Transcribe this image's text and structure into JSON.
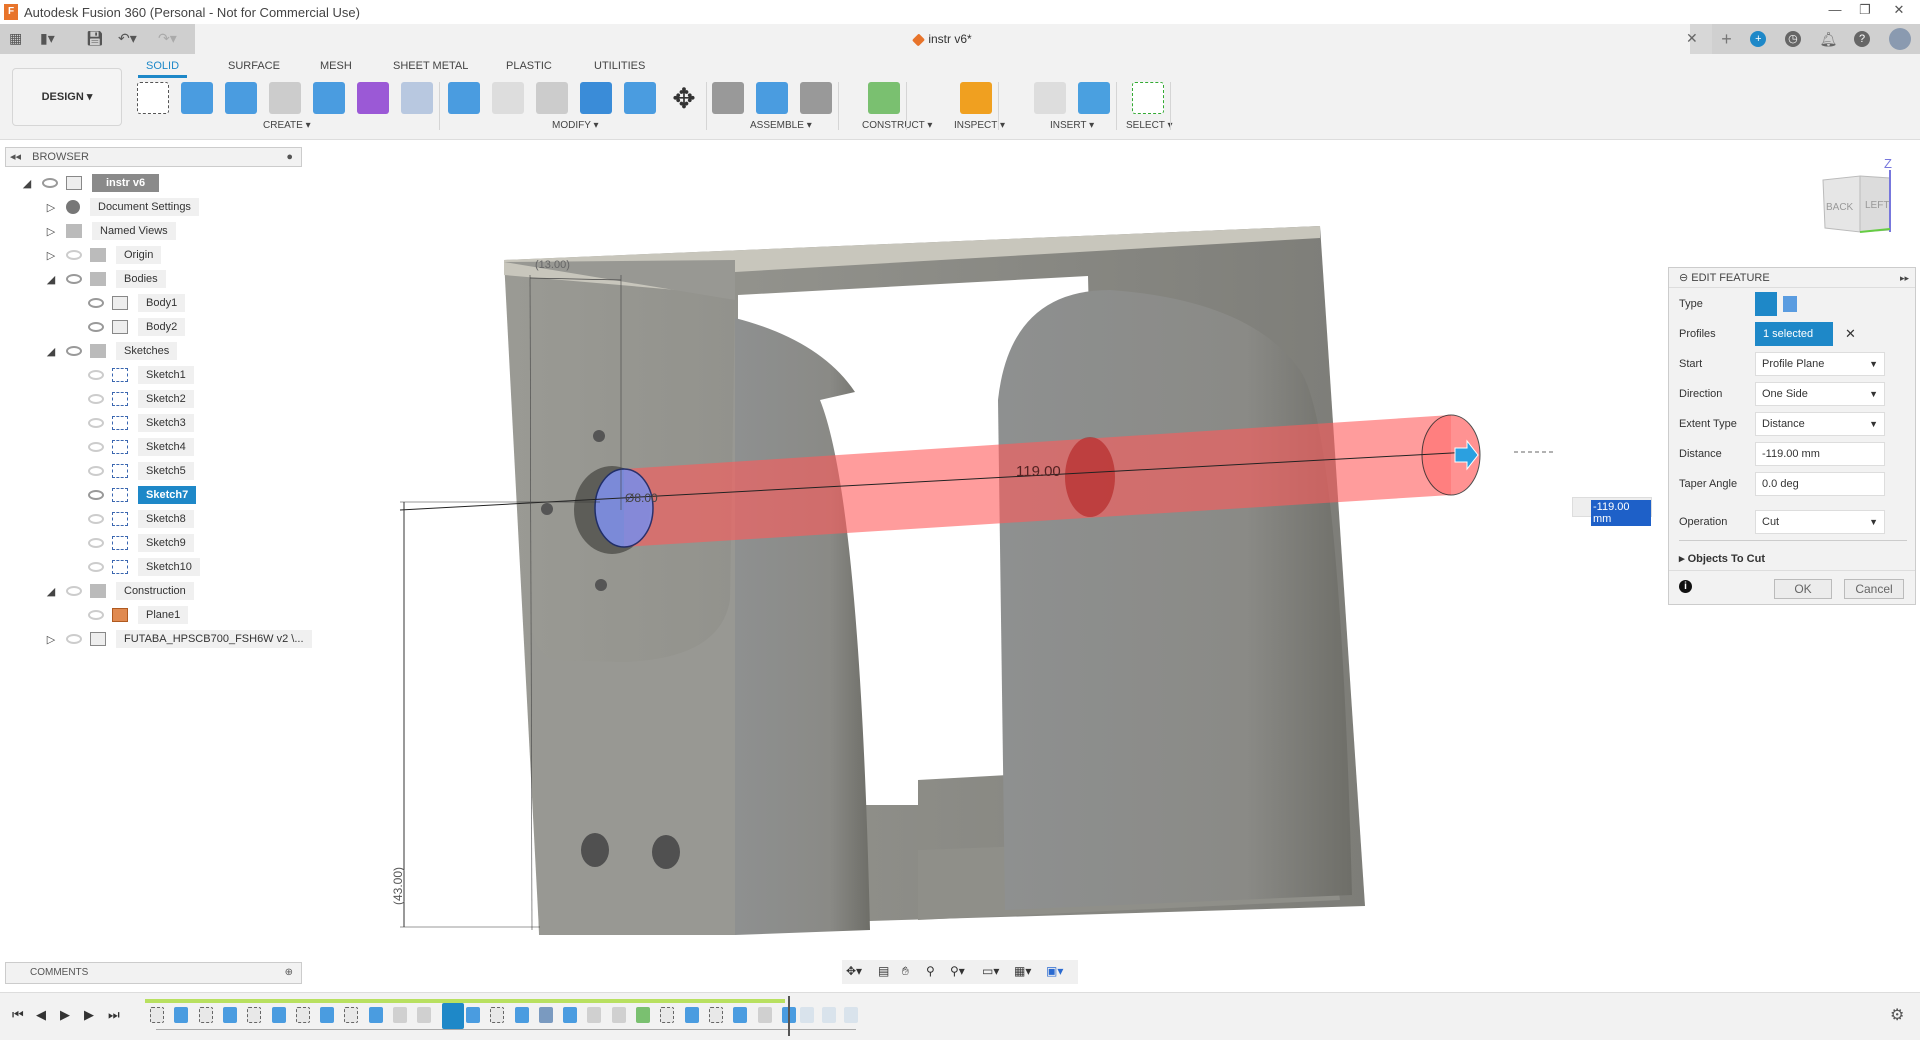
{
  "app": {
    "title": "Autodesk Fusion 360 (Personal - Not for Commercial Use)",
    "document_tab": "instr v6*"
  },
  "colors": {
    "accent": "#1e88c8",
    "cut_preview": "#ff5a5a",
    "profile": "#7f8fe6",
    "body": "#8c8c86"
  },
  "ribbon": {
    "workspace": "DESIGN ▾",
    "tabs": [
      "SOLID",
      "SURFACE",
      "MESH",
      "SHEET METAL",
      "PLASTIC",
      "UTILITIES"
    ],
    "active_tab": "SOLID",
    "groups": [
      {
        "label": "CREATE ▾",
        "icons": [
          "create-sketch-icon",
          "extrude-icon",
          "revolve-icon",
          "hole-icon",
          "pattern-icon",
          "create-form-icon",
          "sweep-icon"
        ]
      },
      {
        "label": "MODIFY ▾",
        "icons": [
          "press-pull-icon",
          "fillet-icon",
          "shell-icon",
          "combine-icon",
          "split-face-icon",
          "move-icon"
        ]
      },
      {
        "label": "ASSEMBLE ▾",
        "icons": [
          "joint-icon",
          "new-component-icon",
          "as-built-joint-icon"
        ]
      },
      {
        "label": "CONSTRUCT ▾",
        "icons": [
          "offset-plane-icon"
        ]
      },
      {
        "label": "INSPECT ▾",
        "icons": [
          "measure-icon"
        ]
      },
      {
        "label": "INSERT ▾",
        "icons": [
          "insert-derive-icon",
          "insert-canvas-icon"
        ]
      },
      {
        "label": "SELECT ▾",
        "icons": [
          "select-window-icon"
        ]
      }
    ]
  },
  "browser": {
    "title": "BROWSER",
    "items": [
      {
        "label": "instr v6",
        "level": 0,
        "expanded": true,
        "icon": "component",
        "eye": "on",
        "style": "root"
      },
      {
        "label": "Document Settings",
        "level": 1,
        "expanded": false,
        "icon": "gear",
        "eye": "none"
      },
      {
        "label": "Named Views",
        "level": 1,
        "expanded": false,
        "icon": "folder",
        "eye": "none"
      },
      {
        "label": "Origin",
        "level": 1,
        "expanded": false,
        "icon": "folder",
        "eye": "off"
      },
      {
        "label": "Bodies",
        "level": 1,
        "expanded": true,
        "icon": "folder",
        "eye": "on"
      },
      {
        "label": "Body1",
        "level": 2,
        "icon": "body",
        "eye": "on"
      },
      {
        "label": "Body2",
        "level": 2,
        "icon": "body",
        "eye": "on"
      },
      {
        "label": "Sketches",
        "level": 1,
        "expanded": true,
        "icon": "folder",
        "eye": "on"
      },
      {
        "label": "Sketch1",
        "level": 2,
        "icon": "sketch",
        "eye": "off"
      },
      {
        "label": "Sketch2",
        "level": 2,
        "icon": "sketch",
        "eye": "off"
      },
      {
        "label": "Sketch3",
        "level": 2,
        "icon": "sketch",
        "eye": "off"
      },
      {
        "label": "Sketch4",
        "level": 2,
        "icon": "sketch",
        "eye": "off"
      },
      {
        "label": "Sketch5",
        "level": 2,
        "icon": "sketch",
        "eye": "off"
      },
      {
        "label": "Sketch7",
        "level": 2,
        "icon": "sketch",
        "eye": "on",
        "style": "sel"
      },
      {
        "label": "Sketch8",
        "level": 2,
        "icon": "sketch",
        "eye": "off"
      },
      {
        "label": "Sketch9",
        "level": 2,
        "icon": "sketch",
        "eye": "off"
      },
      {
        "label": "Sketch10",
        "level": 2,
        "icon": "sketch",
        "eye": "off"
      },
      {
        "label": "Construction",
        "level": 1,
        "expanded": true,
        "icon": "folder",
        "eye": "off"
      },
      {
        "label": "Plane1",
        "level": 2,
        "icon": "plane",
        "eye": "off"
      },
      {
        "label": "FUTABA_HPSCB700_FSH6W v2 \\...",
        "level": 1,
        "expanded": false,
        "icon": "component",
        "eye": "off"
      }
    ]
  },
  "viewport": {
    "dims": {
      "top": "(13.00)",
      "diameter": "Ø8.00",
      "length": "119.00",
      "vertical": "(43.00)"
    },
    "floating_input": "-119.00 mm",
    "viewcube": {
      "faces": [
        "BACK",
        "LEFT"
      ],
      "axis": "Z"
    }
  },
  "edit_feature": {
    "title": "EDIT FEATURE",
    "rows": [
      {
        "label": "Type"
      },
      {
        "label": "Profiles",
        "value": "1 selected"
      },
      {
        "label": "Start",
        "value": "Profile Plane",
        "dropdown": true
      },
      {
        "label": "Direction",
        "value": "One Side",
        "dropdown": true
      },
      {
        "label": "Extent Type",
        "value": "Distance",
        "dropdown": true
      },
      {
        "label": "Distance",
        "value": "-119.00 mm"
      },
      {
        "label": "Taper Angle",
        "value": "0.0 deg"
      },
      {
        "label": "Operation",
        "value": "Cut",
        "dropdown": true
      }
    ],
    "objects_to_cut": "Objects To Cut",
    "ok": "OK",
    "cancel": "Cancel"
  },
  "comments": {
    "title": "COMMENTS"
  },
  "timeline": {
    "items": [
      "sketch",
      "extrude",
      "sketch",
      "extrude",
      "sketch",
      "extrude",
      "sketch",
      "extrude",
      "sketch",
      "extrude",
      "fillet",
      "fillet",
      "sketch-active",
      "extrude",
      "sketch",
      "extrude",
      "joint",
      "extrude",
      "fillet",
      "fillet",
      "plane",
      "sketch",
      "extrude",
      "sketch",
      "extrude",
      "fillet",
      "extrude"
    ],
    "suppressed": [
      "joint",
      "joint",
      "joint"
    ]
  }
}
